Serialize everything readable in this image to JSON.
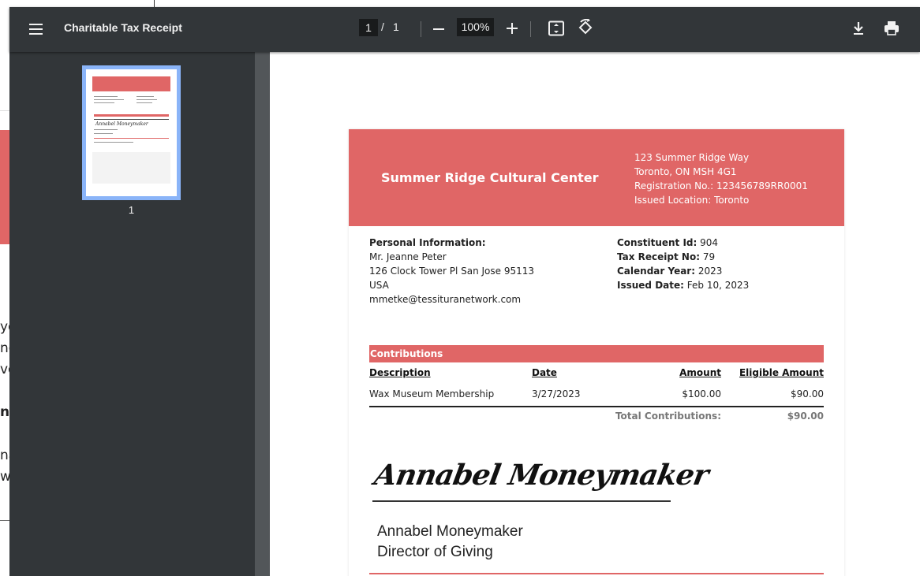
{
  "viewer": {
    "title": "Charitable Tax Receipt",
    "current_page": "1",
    "page_separator": "/",
    "total_pages": "1",
    "zoom": "100%",
    "thumbnail_label": "1"
  },
  "background_fragments": [
    "yo",
    "nc",
    "vo",
    "na",
    "na",
    "w"
  ],
  "receipt": {
    "org_name": "Summer Ridge Cultural Center",
    "address_lines": [
      "123 Summer Ridge Way",
      "Toronto, ON MSH 4G1",
      "Registration No.: 123456789RR0001",
      "Issued Location: Toronto"
    ],
    "personal_heading": "Personal Information:",
    "personal_lines": [
      "Mr. Jeanne Peter",
      "126 Clock Tower Pl San Jose 95113",
      "USA",
      "mmetke@tessituranetwork.com"
    ],
    "details": [
      {
        "label": "Constituent Id:",
        "value": "904"
      },
      {
        "label": "Tax Receipt No:",
        "value": "79"
      },
      {
        "label": "Calendar Year:",
        "value": "2023"
      },
      {
        "label": "Issued Date:",
        "value": "Feb 10, 2023"
      }
    ],
    "contributions_heading": "Contributions",
    "columns": [
      "Description",
      "Date",
      "Amount",
      "Eligible Amount"
    ],
    "rows": [
      {
        "description": "Wax Museum Membership",
        "date": "3/27/2023",
        "amount": "$100.00",
        "eligible": "$90.00"
      }
    ],
    "total_label": "Total Contributions:",
    "total_value": "$90.00",
    "signature": "Annabel Moneymaker",
    "signer_name": "Annabel Moneymaker",
    "signer_title": "Director of Giving"
  },
  "colors": {
    "accent_red": "#e06666",
    "toolbar": "#323639",
    "thumbnail_highlight": "#8ab4f8"
  },
  "icons": [
    "menu-icon",
    "fit-page-icon",
    "rotate-icon",
    "download-icon",
    "print-icon"
  ]
}
